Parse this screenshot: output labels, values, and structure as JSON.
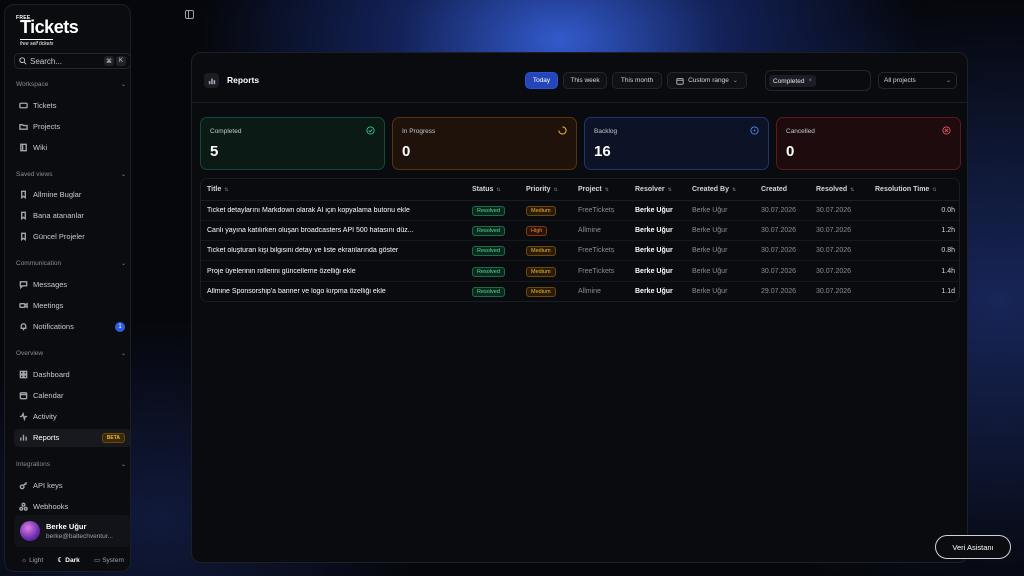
{
  "logo": {
    "free": "FREE",
    "name": "Tickets",
    "tagline": "free self tickets"
  },
  "search": {
    "placeholder": "Search...",
    "kbd1": "⌘",
    "kbd2": "K"
  },
  "sidebar": {
    "sections": [
      {
        "title": "Workspace",
        "items": [
          {
            "label": "Tickets",
            "icon": "ticket-icon"
          },
          {
            "label": "Projects",
            "icon": "folder-icon"
          },
          {
            "label": "Wiki",
            "icon": "book-icon"
          }
        ]
      },
      {
        "title": "Saved views",
        "items": [
          {
            "label": "Allmine Buglar",
            "icon": "bookmark-icon"
          },
          {
            "label": "Bana atananlar",
            "icon": "bookmark-icon"
          },
          {
            "label": "Güncel Projeler",
            "icon": "bookmark-icon"
          }
        ]
      },
      {
        "title": "Communication",
        "items": [
          {
            "label": "Messages",
            "icon": "chat-icon"
          },
          {
            "label": "Meetings",
            "icon": "video-icon"
          },
          {
            "label": "Notifications",
            "icon": "bell-icon",
            "badge": "1"
          }
        ]
      },
      {
        "title": "Overview",
        "items": [
          {
            "label": "Dashboard",
            "icon": "grid-icon"
          },
          {
            "label": "Calendar",
            "icon": "calendar-icon"
          },
          {
            "label": "Activity",
            "icon": "activity-icon"
          },
          {
            "label": "Reports",
            "icon": "chart-icon",
            "badge": "BETA",
            "active": true
          }
        ]
      },
      {
        "title": "Integrations",
        "items": [
          {
            "label": "API keys",
            "icon": "key-icon"
          },
          {
            "label": "Webhooks",
            "icon": "webhook-icon"
          }
        ]
      }
    ]
  },
  "user": {
    "name": "Berke Uğur",
    "email": "berke@baltechventur..."
  },
  "theme": {
    "light": "Light",
    "dark": "Dark",
    "system": "System"
  },
  "header": {
    "title": "Reports",
    "ranges": [
      "Today",
      "This week",
      "This month",
      "Custom range"
    ],
    "active_range": "Today",
    "status_filter": "Completed",
    "project_filter": "All projects"
  },
  "cards": [
    {
      "label": "Completed",
      "value": "5",
      "color": "#34c78a"
    },
    {
      "label": "In Progress",
      "value": "0",
      "color": "#f0a23a"
    },
    {
      "label": "Backlog",
      "value": "16",
      "color": "#4f86f0"
    },
    {
      "label": "Cancelled",
      "value": "0",
      "color": "#e8545c"
    }
  ],
  "table": {
    "columns": [
      "Title",
      "Status",
      "Priority",
      "Project",
      "Resolver",
      "Created By",
      "Created",
      "Resolved",
      "Resolution Time"
    ],
    "rows": [
      {
        "title": "Ticket detaylarını Markdown olarak AI için kopyalama butonu ekle",
        "status": "Resolved",
        "priority": "Medium",
        "project": "FreeTickets",
        "resolver": "Berke Uğur",
        "created_by": "Berke Uğur",
        "created": "30.07.2026",
        "resolved": "30.07.2026",
        "time": "0.0h"
      },
      {
        "title": "Canlı yayına katılırken oluşan broadcasters API 500 hatasını düz...",
        "status": "Resolved",
        "priority": "High",
        "project": "Allmine",
        "resolver": "Berke Uğur",
        "created_by": "Berke Uğur",
        "created": "30.07.2026",
        "resolved": "30.07.2026",
        "time": "1.2h"
      },
      {
        "title": "Ticket oluşturan kişi bilgisini detay ve liste ekranlarında göster",
        "status": "Resolved",
        "priority": "Medium",
        "project": "FreeTickets",
        "resolver": "Berke Uğur",
        "created_by": "Berke Uğur",
        "created": "30.07.2026",
        "resolved": "30.07.2026",
        "time": "0.8h"
      },
      {
        "title": "Proje üyelerinin rollerini güncelleme özelliği ekle",
        "status": "Resolved",
        "priority": "Medium",
        "project": "FreeTickets",
        "resolver": "Berke Uğur",
        "created_by": "Berke Uğur",
        "created": "30.07.2026",
        "resolved": "30.07.2026",
        "time": "1.4h"
      },
      {
        "title": "Allmine Sponsorship'a banner ve logo kırpma özelliği ekle",
        "status": "Resolved",
        "priority": "Medium",
        "project": "Allmine",
        "resolver": "Berke Uğur",
        "created_by": "Berke Uğur",
        "created": "29.07.2026",
        "resolved": "30.07.2026",
        "time": "1.1d"
      }
    ]
  },
  "assistant_button": "Veri Asistanı"
}
